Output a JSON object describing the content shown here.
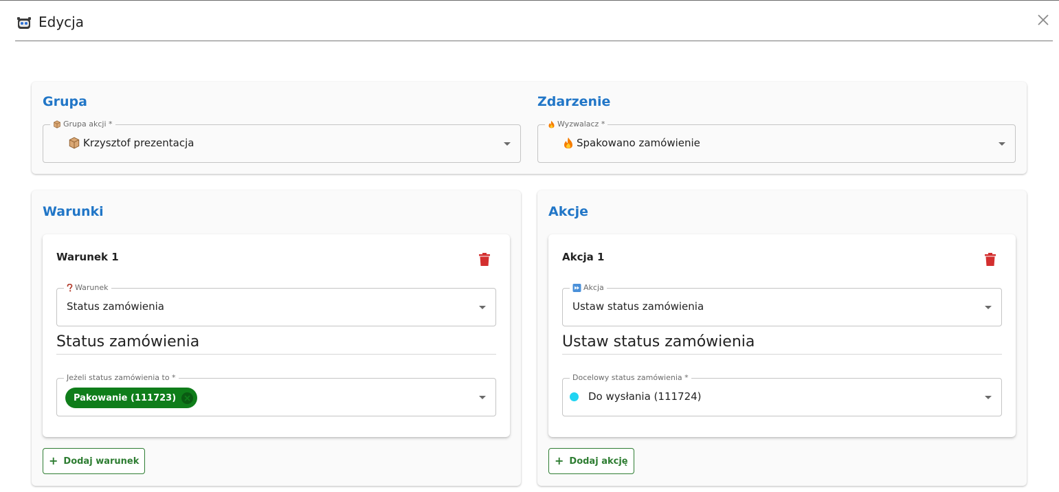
{
  "dialog": {
    "title": "Edycja",
    "logo_icon": "robot-icon",
    "close_icon": "close-icon"
  },
  "group_section": {
    "title": "Grupa",
    "field": {
      "label": "Grupa akcji *",
      "icon": "box-icon",
      "value": "Krzysztof prezentacja"
    }
  },
  "event_section": {
    "title": "Zdarzenie",
    "field": {
      "label": "Wyzwalacz *",
      "icon": "fire-icon",
      "value": "Spakowano zamówienie"
    }
  },
  "conditions": {
    "title": "Warunki",
    "items": [
      {
        "title": "Warunek 1",
        "condition_field": {
          "label": "Warunek",
          "icon": "question-icon",
          "value": "Status zamówienia"
        },
        "heading": "Status zamówienia",
        "status_field": {
          "label": "Jeżeli status zamówienia to *",
          "chip": "Pakowanie (111723)"
        }
      }
    ],
    "add_label": "Dodaj warunek"
  },
  "actions": {
    "title": "Akcje",
    "items": [
      {
        "title": "Akcja 1",
        "action_field": {
          "label": "Akcja",
          "icon": "fast-forward-icon",
          "value": "Ustaw status zamówienia"
        },
        "heading": "Ustaw status zamówienia",
        "status_field": {
          "label": "Docelowy status zamówienia *",
          "value": "Do wysłania (111724)",
          "dot_color": "#21d4f2"
        }
      }
    ],
    "add_label": "Dodaj akcję"
  },
  "colors": {
    "section_title": "#2176c7",
    "danger": "#d32f2f",
    "success": "#2e7d32",
    "chip_bg": "#0f7d1a"
  }
}
